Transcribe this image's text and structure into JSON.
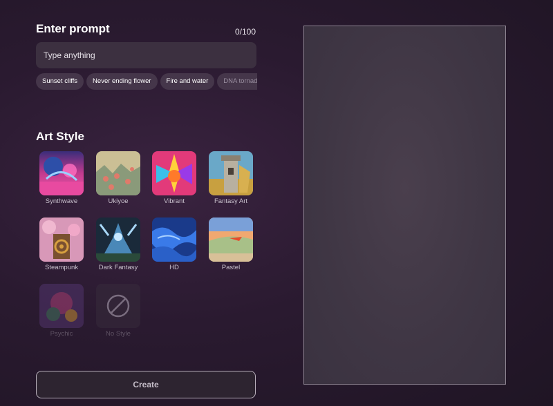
{
  "prompt": {
    "title": "Enter prompt",
    "counter": "0/100",
    "placeholder": "Type anything"
  },
  "suggestions": [
    "Sunset cliffs",
    "Never ending flower",
    "Fire and water",
    "DNA tornado"
  ],
  "art_style": {
    "title": "Art Style",
    "styles": [
      {
        "label": "Synthwave",
        "icon": "synthwave-thumbnail"
      },
      {
        "label": "Ukiyoe",
        "icon": "ukiyoe-thumbnail"
      },
      {
        "label": "Vibrant",
        "icon": "vibrant-thumbnail"
      },
      {
        "label": "Fantasy Art",
        "icon": "fantasy-art-thumbnail"
      },
      {
        "label": "Steampunk",
        "icon": "steampunk-thumbnail"
      },
      {
        "label": "Dark Fantasy",
        "icon": "dark-fantasy-thumbnail"
      },
      {
        "label": "HD",
        "icon": "hd-thumbnail"
      },
      {
        "label": "Pastel",
        "icon": "pastel-thumbnail"
      },
      {
        "label": "Psychic",
        "icon": "psychic-thumbnail"
      },
      {
        "label": "No Style",
        "icon": "no-style-icon"
      }
    ]
  },
  "create_label": "Create",
  "colors": {
    "background": "#2a1a30",
    "input_bg": "#3c3040",
    "chip_bg": "#45364a",
    "preview_bg": "#443a48",
    "preview_border": "#8f8693"
  }
}
